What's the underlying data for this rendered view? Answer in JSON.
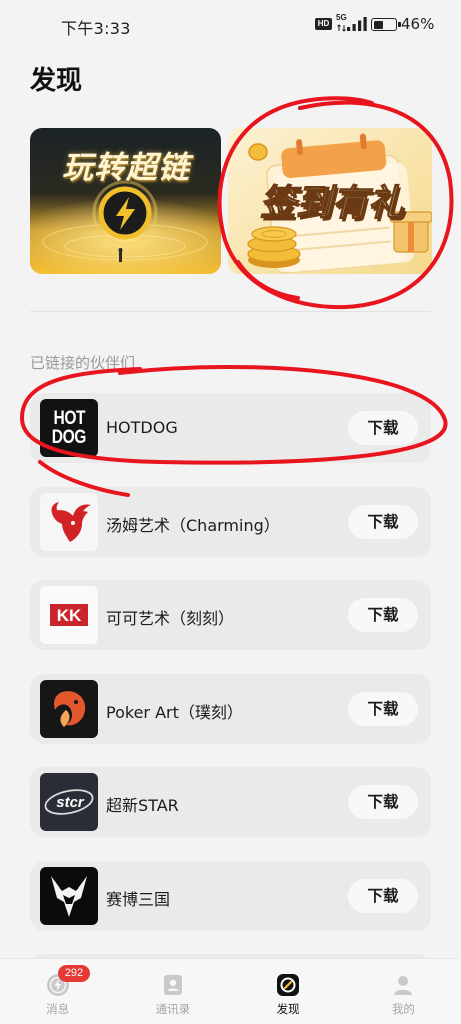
{
  "status_bar": {
    "time": "下午3:33",
    "hd": "HD",
    "network": "5G",
    "signal_icon": "signal-icon",
    "battery": {
      "label": "46%",
      "level": 0.46,
      "icon": "battery-icon"
    }
  },
  "page": {
    "title": "发现"
  },
  "banners": [
    {
      "title": "玩转超链"
    },
    {
      "title": "签到有礼"
    }
  ],
  "section": {
    "label": "已链接的伙伴们"
  },
  "partners": [
    {
      "name": "HOTDOG",
      "logo_text": [
        "HOT",
        "DOG"
      ],
      "button": "下载"
    },
    {
      "name": "汤姆艺术（Charming）",
      "button": "下载"
    },
    {
      "name": "可可艺术（刻刻）",
      "logo_text": "KK",
      "button": "下载"
    },
    {
      "name": "Poker Art（璞刻）",
      "button": "下载"
    },
    {
      "name": "超新STAR",
      "logo_text": "stcr",
      "button": "下载"
    },
    {
      "name": "赛博三国",
      "button": "下载"
    }
  ],
  "tab_bar": {
    "items": [
      {
        "label": "消息",
        "icon": "message-icon",
        "badge": "292",
        "active": false
      },
      {
        "label": "通讯录",
        "icon": "contacts-icon",
        "active": false
      },
      {
        "label": "发现",
        "icon": "discover-icon",
        "active": true
      },
      {
        "label": "我的",
        "icon": "profile-icon",
        "active": false
      }
    ]
  },
  "colors": {
    "badge": "#e53935",
    "annotation": "#e8141e",
    "active_tab": "#111111",
    "inactive_tab": "#a5a5a5"
  }
}
